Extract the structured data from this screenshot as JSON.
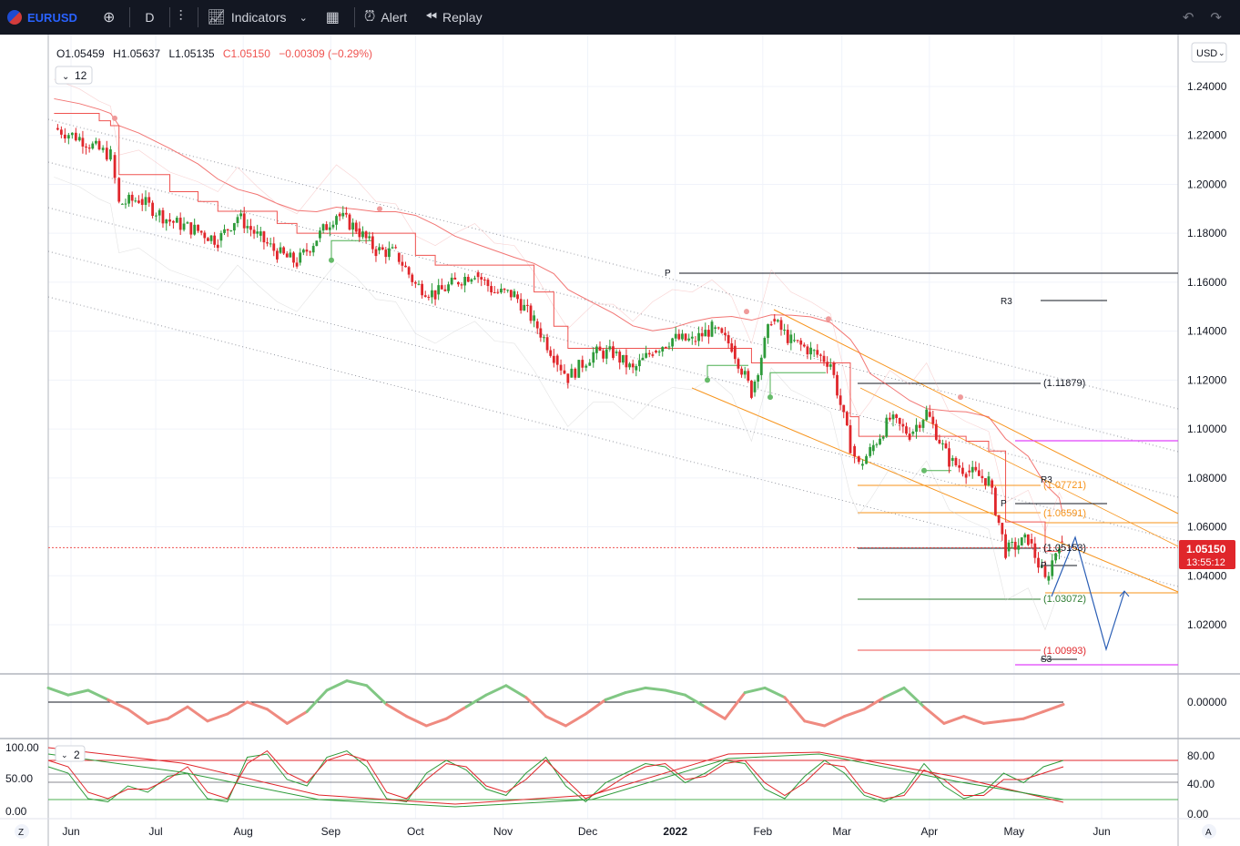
{
  "toolbar": {
    "symbol": "EURUSD",
    "interval": "D",
    "indicators_label": "Indicators",
    "alert_label": "Alert",
    "replay_label": "Replay"
  },
  "legend": {
    "open": "O1.05459",
    "high": "H1.05637",
    "low": "L1.05135",
    "close": "C1.05150",
    "change": "−0.00309 (−0.29%)",
    "collapse_count": "12"
  },
  "currency_button": "USD",
  "price_tag": {
    "price": "1.05150",
    "countdown": "13:55:12"
  },
  "osc2_badge": "2",
  "bottom_left_button": "Z",
  "bottom_right_button": "A",
  "levels": {
    "p_top": "P",
    "r3_top": "R3",
    "l1": "(1.11879)",
    "r3_mid": "R3",
    "l2": "(1.07721)",
    "p_mid": "P",
    "l3": "(1.06591)",
    "l4": "(1.05153)",
    "p_low": "P",
    "l5": "(1.03072)",
    "l6": "(1.00993)",
    "s3": "S3"
  },
  "colors": {
    "up": "#26a69a",
    "down": "#ef5350",
    "candle_up": "#2e9b3a",
    "candle_down": "#e0262b",
    "orange": "#f7931a",
    "magenta": "#e040fb",
    "blue": "#2962ff"
  },
  "chart_data": [
    {
      "type": "candlestick",
      "title": "",
      "x_ticks": [
        "Jun",
        "Jul",
        "Aug",
        "Sep",
        "Oct",
        "Nov",
        "Dec",
        "2022",
        "Feb",
        "Mar",
        "Apr",
        "May",
        "Jun"
      ],
      "y_ticks": [
        "1.24000",
        "1.22000",
        "1.20000",
        "1.18000",
        "1.16000",
        "1.14000",
        "1.12000",
        "1.10000",
        "1.08000",
        "1.06000",
        "1.04000",
        "1.02000"
      ],
      "ylim": [
        1.0,
        1.255
      ],
      "last_price": 1.0515,
      "close_path": [
        [
          "2021-05-26",
          1.223
        ],
        [
          "2021-06-04",
          1.219
        ],
        [
          "2021-06-11",
          1.214
        ],
        [
          "2021-06-15",
          1.212
        ],
        [
          "2021-06-18",
          1.192
        ],
        [
          "2021-06-25",
          1.194
        ],
        [
          "2021-07-06",
          1.185
        ],
        [
          "2021-07-16",
          1.181
        ],
        [
          "2021-07-23",
          1.177
        ],
        [
          "2021-07-30",
          1.187
        ],
        [
          "2021-08-06",
          1.179
        ],
        [
          "2021-08-13",
          1.172
        ],
        [
          "2021-08-20",
          1.168
        ],
        [
          "2021-08-27",
          1.178
        ],
        [
          "2021-09-03",
          1.188
        ],
        [
          "2021-09-10",
          1.182
        ],
        [
          "2021-09-17",
          1.173
        ],
        [
          "2021-09-24",
          1.172
        ],
        [
          "2021-10-01",
          1.159
        ],
        [
          "2021-10-08",
          1.155
        ],
        [
          "2021-10-15",
          1.16
        ],
        [
          "2021-10-22",
          1.164
        ],
        [
          "2021-10-29",
          1.156
        ],
        [
          "2021-11-05",
          1.155
        ],
        [
          "2021-11-12",
          1.144
        ],
        [
          "2021-11-19",
          1.13
        ],
        [
          "2021-11-24",
          1.121
        ],
        [
          "2021-12-03",
          1.131
        ],
        [
          "2021-12-10",
          1.131
        ],
        [
          "2021-12-17",
          1.124
        ],
        [
          "2021-12-24",
          1.132
        ],
        [
          "2021-12-31",
          1.137
        ],
        [
          "2022-01-07",
          1.136
        ],
        [
          "2022-01-14",
          1.141
        ],
        [
          "2022-01-21",
          1.134
        ],
        [
          "2022-01-28",
          1.115
        ],
        [
          "2022-02-04",
          1.145
        ],
        [
          "2022-02-11",
          1.136
        ],
        [
          "2022-02-18",
          1.132
        ],
        [
          "2022-02-25",
          1.127
        ],
        [
          "2022-03-04",
          1.093
        ],
        [
          "2022-03-07",
          1.085
        ],
        [
          "2022-03-11",
          1.091
        ],
        [
          "2022-03-18",
          1.104
        ],
        [
          "2022-03-25",
          1.098
        ],
        [
          "2022-03-31",
          1.107
        ],
        [
          "2022-04-08",
          1.087
        ],
        [
          "2022-04-14",
          1.083
        ],
        [
          "2022-04-22",
          1.079
        ],
        [
          "2022-04-28",
          1.05
        ],
        [
          "2022-05-06",
          1.055
        ],
        [
          "2022-05-12",
          1.038
        ],
        [
          "2022-05-17",
          1.054
        ],
        [
          "2022-05-18",
          1.0515
        ]
      ]
    },
    {
      "type": "line",
      "title": "",
      "y_ticks": [
        "0.00000"
      ],
      "values_note_free": true,
      "series": [
        {
          "values": [
            0.6,
            0.3,
            0.5,
            0.1,
            -0.3,
            -0.9,
            -0.7,
            -0.2,
            -0.8,
            -0.5,
            0.0,
            -0.3,
            -0.9,
            -0.4,
            0.5,
            0.9,
            0.7,
            -0.1,
            -0.6,
            -1.0,
            -0.7,
            -0.2,
            0.3,
            0.7,
            0.2,
            -0.6,
            -1.0,
            -0.5,
            0.1,
            0.4,
            0.6,
            0.5,
            0.3,
            -0.2,
            -0.7,
            0.4,
            0.6,
            0.2,
            -0.8,
            -1.0,
            -0.6,
            -0.3,
            0.2,
            0.6,
            -0.2,
            -0.9,
            -0.6,
            -0.9,
            -0.8,
            -0.7,
            -0.4,
            -0.1
          ]
        }
      ]
    },
    {
      "type": "line",
      "title": "",
      "y_ticks_left": [
        "100.00",
        "50.00",
        "0.00"
      ],
      "y_ticks_right": [
        "80.00",
        "40.00",
        "0.00"
      ],
      "series": [
        {
          "values": [
            70,
            60,
            20,
            15,
            40,
            30,
            55,
            60,
            20,
            15,
            85,
            90,
            50,
            40,
            85,
            95,
            70,
            20,
            15,
            60,
            80,
            65,
            35,
            25,
            60,
            85,
            40,
            15,
            45,
            60,
            75,
            70,
            45,
            60,
            80,
            75,
            35,
            20,
            55,
            80,
            60,
            25,
            15,
            30,
            75,
            40,
            20,
            30,
            60,
            45,
            70,
            80
          ]
        },
        {
          "values": [
            80,
            70,
            30,
            20,
            35,
            35,
            50,
            70,
            30,
            20,
            75,
            95,
            60,
            45,
            80,
            90,
            80,
            30,
            20,
            50,
            75,
            70,
            40,
            30,
            50,
            80,
            50,
            20,
            35,
            55,
            70,
            75,
            50,
            55,
            75,
            80,
            45,
            25,
            45,
            75,
            70,
            30,
            20,
            25,
            65,
            50,
            25,
            25,
            50,
            50,
            60,
            70
          ]
        }
      ]
    }
  ]
}
